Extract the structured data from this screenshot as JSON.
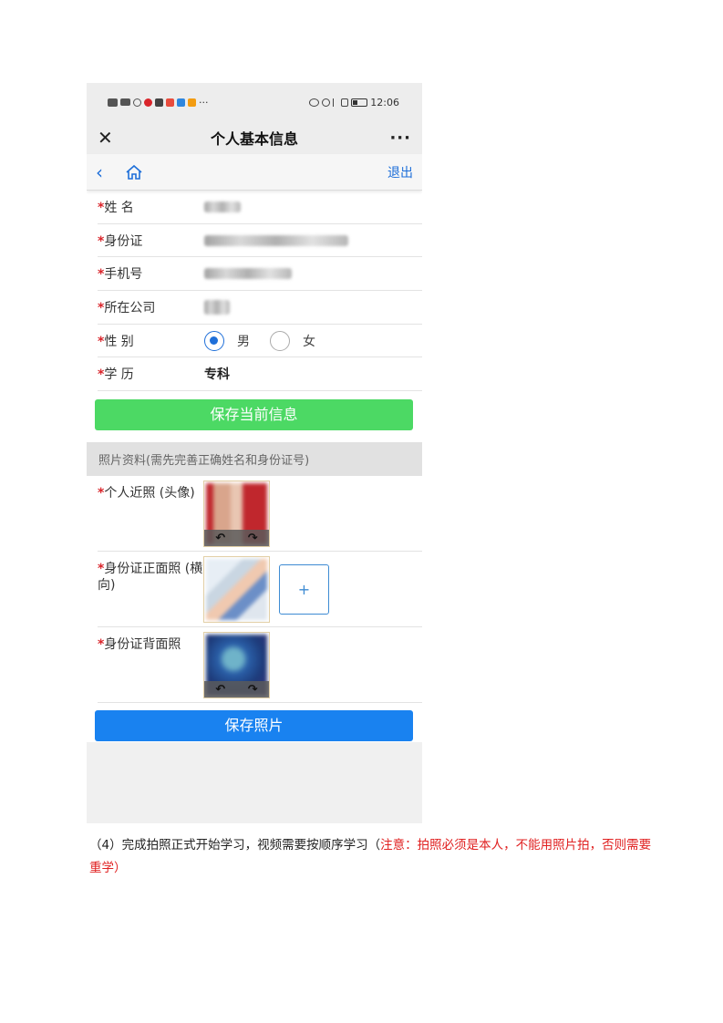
{
  "status_bar": {
    "time": "12:06",
    "overflow_marker": "···"
  },
  "title_bar": {
    "close_symbol": "✕",
    "title": "个人基本信息",
    "more_symbol": "···"
  },
  "nav_bar": {
    "back_symbol": "‹",
    "logout_label": "退出"
  },
  "form": {
    "required_mark": "*",
    "fields": [
      {
        "label": "姓 名"
      },
      {
        "label": "身份证"
      },
      {
        "label": "手机号"
      },
      {
        "label": "所在公司"
      },
      {
        "label": "性 别"
      },
      {
        "label": "学 历",
        "value": "专科"
      }
    ],
    "gender_options": [
      {
        "label": "男",
        "selected": true
      },
      {
        "label": "女",
        "selected": false
      }
    ],
    "save_info_label": "保存当前信息"
  },
  "photos": {
    "section_title": "照片资料(需先完善正确姓名和身份证号)",
    "items": [
      {
        "label": "个人近照 (头像)"
      },
      {
        "label": "身份证正面照 (横向)"
      },
      {
        "label": "身份证背面照"
      }
    ],
    "rotate_left": "↶",
    "rotate_right": "↷",
    "add_symbol": "+",
    "save_photo_label": "保存照片"
  },
  "caption": {
    "prefix": "（4）完成拍照正式开始学习，视频需要按顺序学习（",
    "note": "注意：拍照必须是本人，不能用照片拍，否则需要重学",
    "suffix": "）"
  },
  "colors": {
    "accent_blue": "#1e6fd9",
    "save_green": "#4cd964",
    "save_blue": "#1982f0",
    "required_red": "#d9252b",
    "note_red": "#e02020"
  }
}
